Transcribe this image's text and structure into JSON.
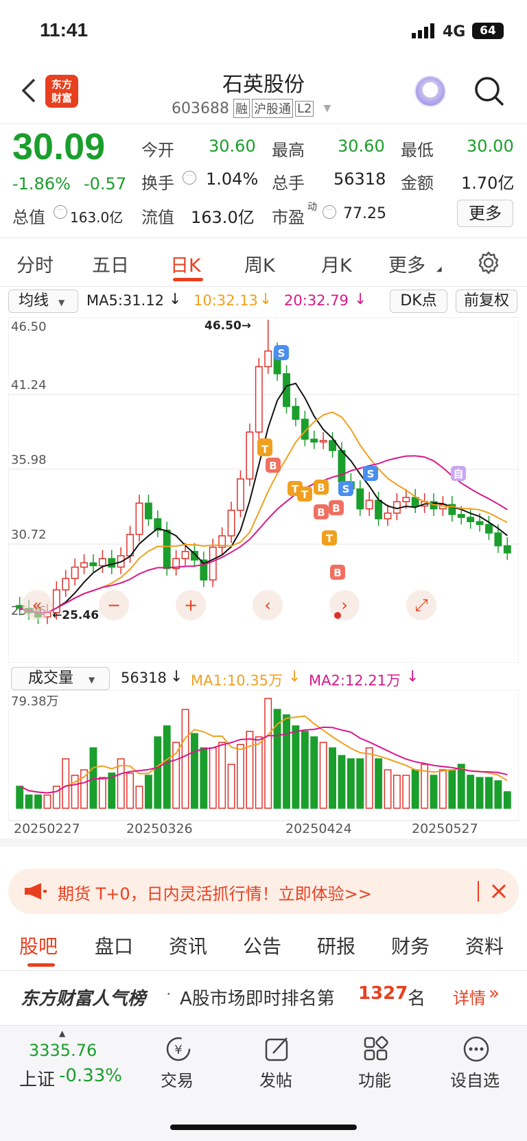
{
  "status_bar": {
    "time": "11:41",
    "network": "4G",
    "battery": "64"
  },
  "header": {
    "title": "石英股份",
    "code": "603688",
    "tags": [
      "融",
      "沪股通",
      "L2"
    ]
  },
  "quote": {
    "price": "30.09",
    "change_pct": "-1.86%",
    "change": "-0.57",
    "stats": [
      {
        "label": "今开",
        "value": "30.60",
        "color": "green"
      },
      {
        "label": "最高",
        "value": "30.60",
        "color": "green"
      },
      {
        "label": "最低",
        "value": "30.00",
        "color": "green"
      },
      {
        "label": "换手",
        "value": "1.04%",
        "color": "dark"
      },
      {
        "label": "总手",
        "value": "56318",
        "color": "dark"
      },
      {
        "label": "金额",
        "value": "1.70亿",
        "color": "dark"
      }
    ],
    "total_value_label": "总值",
    "total_value": "163.0亿",
    "float_label": "流值",
    "float_value": "163.0亿",
    "pe_label": "市盈",
    "pe_sup": "动",
    "pe_value": "77.25",
    "more_label": "更多"
  },
  "tabs": [
    "分时",
    "五日",
    "日K",
    "周K",
    "月K",
    "更多"
  ],
  "ma_bar": {
    "selector": "均线",
    "ma5": "MA5:31.12",
    "ma10": "10:32.13",
    "ma20": "20:32.79",
    "dk": "DK点",
    "fq": "前复权"
  },
  "chart_data": {
    "type": "candlestick",
    "y_ticks": [
      "46.50",
      "41.24",
      "35.98",
      "30.72",
      "25.46"
    ],
    "ylim": [
      25.46,
      46.5
    ],
    "high_label": "46.50→",
    "low_label": "←25.46",
    "signals": [
      "S",
      "B",
      "T",
      "B",
      "T",
      "T",
      "T",
      "B",
      "T",
      "S",
      "S",
      "B",
      "B",
      "自"
    ],
    "x_dates": [
      "20250227",
      "20250326",
      "20250424",
      "20250527"
    ],
    "volume": {
      "label": "成交量",
      "value": "56318",
      "ma1": "MA1:10.35万",
      "ma2": "MA2:12.21万",
      "max": "79.38万"
    }
  },
  "banner": {
    "text": "期货 T+0，日内灵活抓行情！立即体验>>"
  },
  "bottom_tabs": [
    "股吧",
    "盘口",
    "资讯",
    "公告",
    "研报",
    "财务",
    "资料"
  ],
  "rank": {
    "brand": "东方财富人气榜",
    "text": "A股市场即时排名第",
    "rank": "1327",
    "suffix": "名",
    "detail": "详情"
  },
  "nav": {
    "index_value": "3335.76",
    "index_name": "上证",
    "index_change": "-0.33%",
    "items": [
      "交易",
      "发帖",
      "功能",
      "设自选"
    ]
  }
}
